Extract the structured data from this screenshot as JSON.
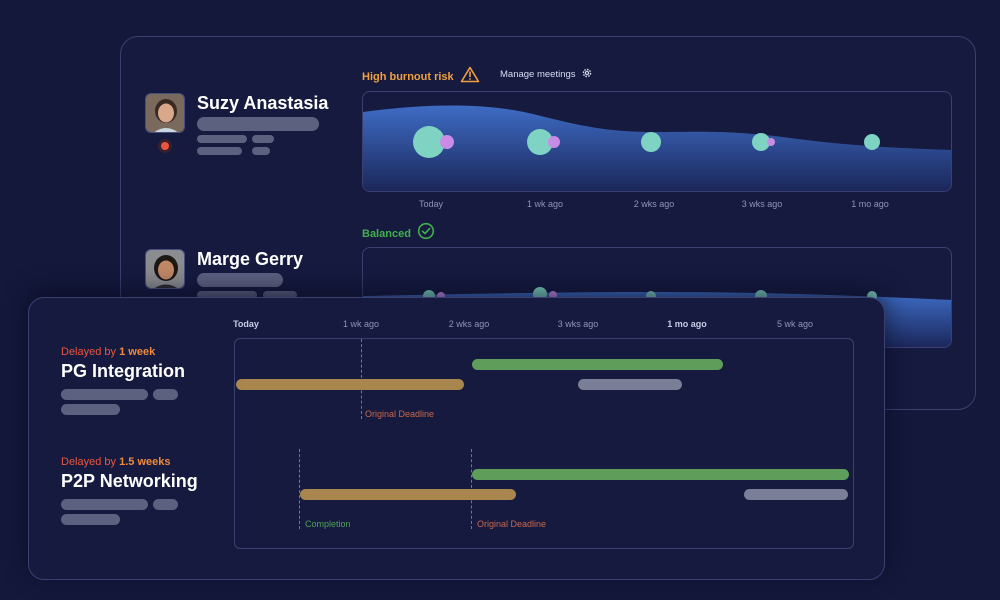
{
  "people": [
    {
      "name": "Suzy Anastasia",
      "status": "High burnout risk",
      "status_icon": "warning-triangle-icon",
      "status_color": "#f0a040"
    },
    {
      "name": "Marge Gerry",
      "status": "Balanced",
      "status_icon": "check-circle-icon",
      "status_color": "#3fb04a"
    }
  ],
  "manage_meetings": {
    "label": "Manage meetings",
    "icon": "gear-icon"
  },
  "timeline_labels": [
    "Today",
    "1 wk ago",
    "2 wks ago",
    "3 wks ago",
    "1 mo ago"
  ],
  "gantt_labels": [
    "Today",
    "1 wk ago",
    "2 wks ago",
    "3 wks ago",
    "1 mo ago",
    "5 wk ago"
  ],
  "projects": [
    {
      "delay_prefix": "Delayed by",
      "delay_amount": "1 week",
      "name": "PG Integration",
      "markers": [
        "Original Deadline"
      ]
    },
    {
      "delay_prefix": "Delayed by",
      "delay_amount": "1.5 weeks",
      "name": "P2P Networking",
      "markers": [
        "Completion",
        "Original Deadline"
      ]
    }
  ],
  "colors": {
    "background": "#14183b",
    "warning": "#f0a040",
    "success": "#3fb04a",
    "delay": "#e9573f",
    "bar_green": "#5e9e5a",
    "bar_orange": "#a8864e",
    "bar_grey": "#7a7e96"
  }
}
